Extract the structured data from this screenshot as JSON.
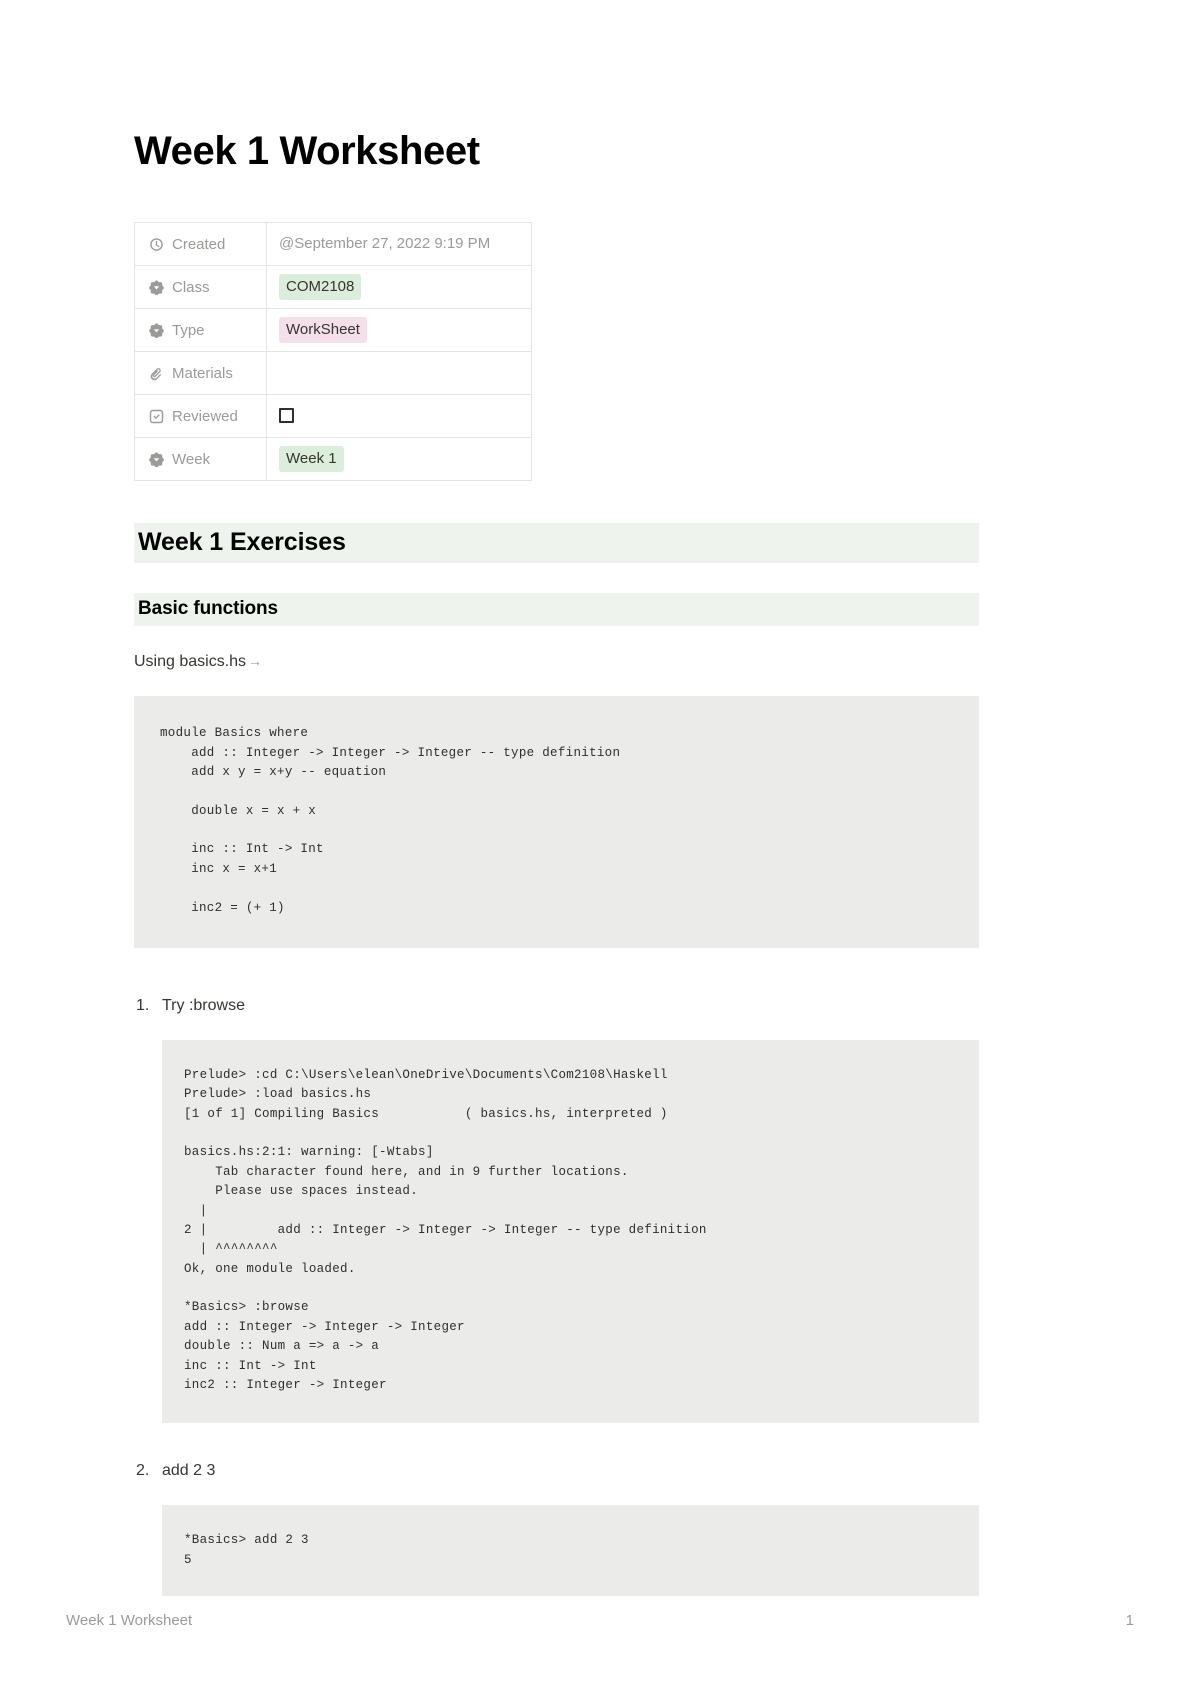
{
  "document": {
    "title": "Week 1 Worksheet"
  },
  "properties": {
    "rows": [
      {
        "icon": "clock-icon",
        "label": "Created",
        "value": "@September 27, 2022 9:19 PM",
        "value_type": "text"
      },
      {
        "icon": "select-chevron-icon",
        "label": "Class",
        "value": "COM2108",
        "value_type": "pill-green"
      },
      {
        "icon": "select-chevron-icon",
        "label": "Type",
        "value": "WorkSheet",
        "value_type": "pill-pink"
      },
      {
        "icon": "paperclip-icon",
        "label": "Materials",
        "value": "",
        "value_type": "empty"
      },
      {
        "icon": "checkbox-property-icon",
        "label": "Reviewed",
        "value": "",
        "value_type": "checkbox",
        "checked": false
      },
      {
        "icon": "select-chevron-icon",
        "label": "Week",
        "value": "Week 1",
        "value_type": "pill-green"
      }
    ]
  },
  "headings": {
    "section": "Week 1 Exercises",
    "subsection": "Basic functions"
  },
  "intro": {
    "text": "Using basics.hs",
    "arrow_glyph": "→"
  },
  "code_blocks": {
    "basics_module": "module Basics where\n    add :: Integer -> Integer -> Integer -- type definition\n    add x y = x+y -- equation\n\n    double x = x + x\n\n    inc :: Int -> Int\n    inc x = x+1\n\n    inc2 = (+ 1)",
    "ghci_browse": "Prelude> :cd C:\\Users\\elean\\OneDrive\\Documents\\Com2108\\Haskell\nPrelude> :load basics.hs\n[1 of 1] Compiling Basics           ( basics.hs, interpreted )\n\nbasics.hs:2:1: warning: [-Wtabs]\n    Tab character found here, and in 9 further locations.\n    Please use spaces instead.\n  |\n2 |         add :: Integer -> Integer -> Integer -- type definition\n  | ^^^^^^^^\nOk, one module loaded.\n\n*Basics> :browse\nadd :: Integer -> Integer -> Integer\ndouble :: Num a => a -> a\ninc :: Int -> Int\ninc2 :: Integer -> Integer",
    "ghci_add": "*Basics> add 2 3\n5"
  },
  "steps": [
    {
      "label": "Try :browse"
    },
    {
      "label": "add 2 3"
    }
  ],
  "footer": {
    "left": "Week 1 Worksheet",
    "page_number": "1"
  },
  "colors": {
    "pill_green": "#dbeddb",
    "pill_pink": "#f4dfeb",
    "heading_highlight": "#eef3ed",
    "code_background": "#ebebea",
    "muted_text": "#9b9a97",
    "body_text": "#37352f"
  }
}
